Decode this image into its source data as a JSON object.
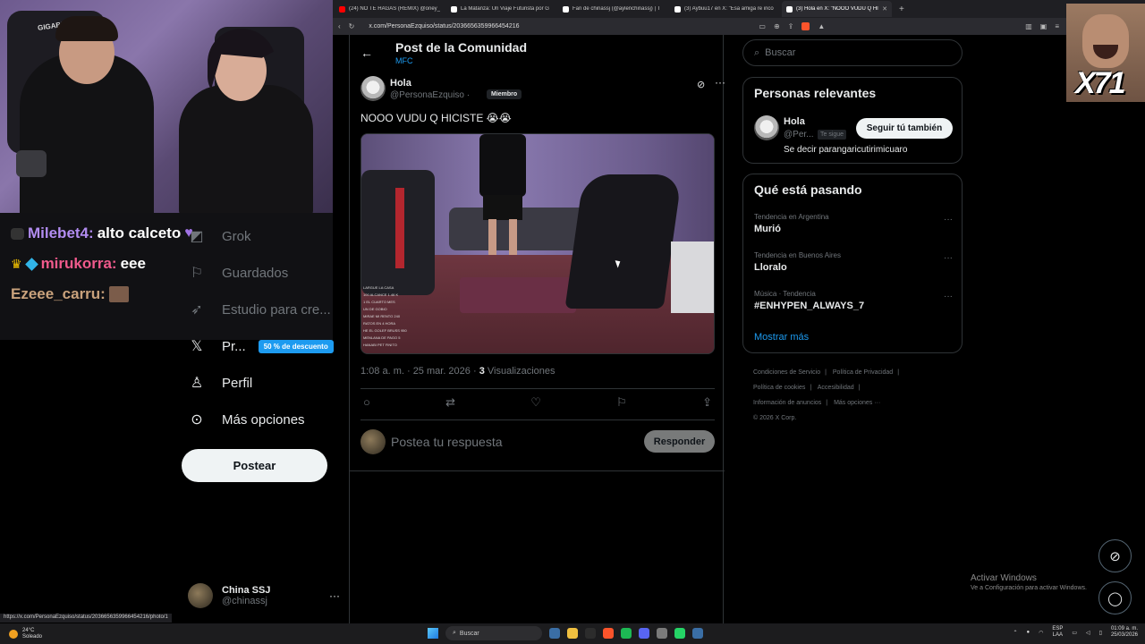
{
  "browser": {
    "tabs": [
      {
        "label": "(24) NO TE HAGAS (REMIX) @oney_",
        "color": "#ff0000",
        "active": false
      },
      {
        "label": "La Matanza: Un Viaje Futurista por G",
        "color": "#ffffff",
        "active": false
      },
      {
        "label": "Fan de chinassj (@aylenchinassj) | T",
        "color": "#ffffff",
        "active": false
      },
      {
        "label": "(3) Aybuu17 en X: \"Esa amiga re inco",
        "color": "#ffffff",
        "active": false
      },
      {
        "label": "(3) Hola en X: \"NOOO VUDU Q HI",
        "color": "#ffffff",
        "active": true
      }
    ],
    "new_tab": "+",
    "url": "x.com/PersonaEzquiso/status/2036656359966454216",
    "status_url": "https://x.com/PersonaEzquiso/status/2036656359966454216/photo/1"
  },
  "chat": [
    {
      "user": "Milebet4:",
      "message": "alto calceto"
    },
    {
      "user": "mirukorra:",
      "message": "eee"
    },
    {
      "user": "Ezeee_carru:",
      "message": ""
    }
  ],
  "webcam": {
    "chair_brand": "GIGABYTE"
  },
  "meme": {
    "count": "X71"
  },
  "nav": {
    "items": [
      {
        "label": "Grok",
        "icon": "grok-icon"
      },
      {
        "label": "Guardados",
        "icon": "bookmark-icon"
      },
      {
        "label": "Estudio para cre...",
        "icon": "rocket-icon"
      },
      {
        "label": "Pr...",
        "icon": "x-logo-icon"
      },
      {
        "label": "Perfil",
        "icon": "person-icon"
      },
      {
        "label": "Más opciones",
        "icon": "more-circle-icon"
      }
    ],
    "premium_badge": "50 % de descuento",
    "post_button": "Postear",
    "account": {
      "name": "China SSJ",
      "handle": "@chinassj",
      "more": "···"
    }
  },
  "post": {
    "header_title": "Post de la Comunidad",
    "header_sub": "MFC",
    "author_name": "Hola",
    "author_handle": "@PersonaEzquiso ·",
    "member_tag": "Miembro",
    "text": "NOOO VUDU Q HICISTE 😭😭",
    "time": "1:08 a. m. · 25 mar. 2026 ·",
    "views_count": "3",
    "views_label": "Visualizaciones",
    "reply_placeholder": "Postea tu respuesta",
    "reply_button": "Responder",
    "media_overlay": [
      "LARGUE LA CASA",
      "100 ALCANCE 1.46 K",
      "1 EL CUARTO MES",
      "UN DE GOBIO",
      "MIRAE MI RENTO 240",
      "RATOS EN 4 HORA",
      "HE EL GOLEF BRUSS 950",
      "MENLANA DE PAGO 5",
      "HANABI PET FINITO"
    ]
  },
  "sidebar": {
    "search_placeholder": "Buscar",
    "relevant": {
      "title": "Personas relevantes",
      "name": "Hola",
      "handle": "@Per...",
      "follows_you": "Te sigue",
      "follow_button": "Seguir tú también",
      "bio": "Se decir parangaricutirimicuaro"
    },
    "trending": {
      "title": "Qué está pasando",
      "items": [
        {
          "context": "Tendencia en Argentina",
          "name": "Murió"
        },
        {
          "context": "Tendencia en Buenos Aires",
          "name": "Lloralo"
        },
        {
          "context": "Música · Tendencia",
          "name": "#ENHYPEN_ALWAYS_7"
        }
      ],
      "show_more": "Mostrar más"
    },
    "footer": {
      "terms": "Condiciones de Servicio",
      "privacy": "Política de Privacidad",
      "cookies": "Política de cookies",
      "accessibility": "Accesibilidad",
      "ads": "Información de anuncios",
      "more": "Más opciones ···",
      "copyright": "© 2026 X Corp."
    }
  },
  "activate_windows": {
    "title": "Activar Windows",
    "subtitle": "Ve a Configuración para activar Windows."
  },
  "taskbar": {
    "weather_temp": "24°C",
    "weather_desc": "Soleado",
    "search": "Buscar",
    "lang_top": "ESP",
    "lang_bottom": "LAA",
    "time": "01:09 a. m.",
    "date": "25/03/2026",
    "app_colors": [
      "#3a6ea5",
      "#f0c040",
      "#2c2c2c",
      "#fb542b",
      "#1db954",
      "#5865f2",
      "#7a7a7a",
      "#25d366",
      "#3a6ea5"
    ]
  }
}
